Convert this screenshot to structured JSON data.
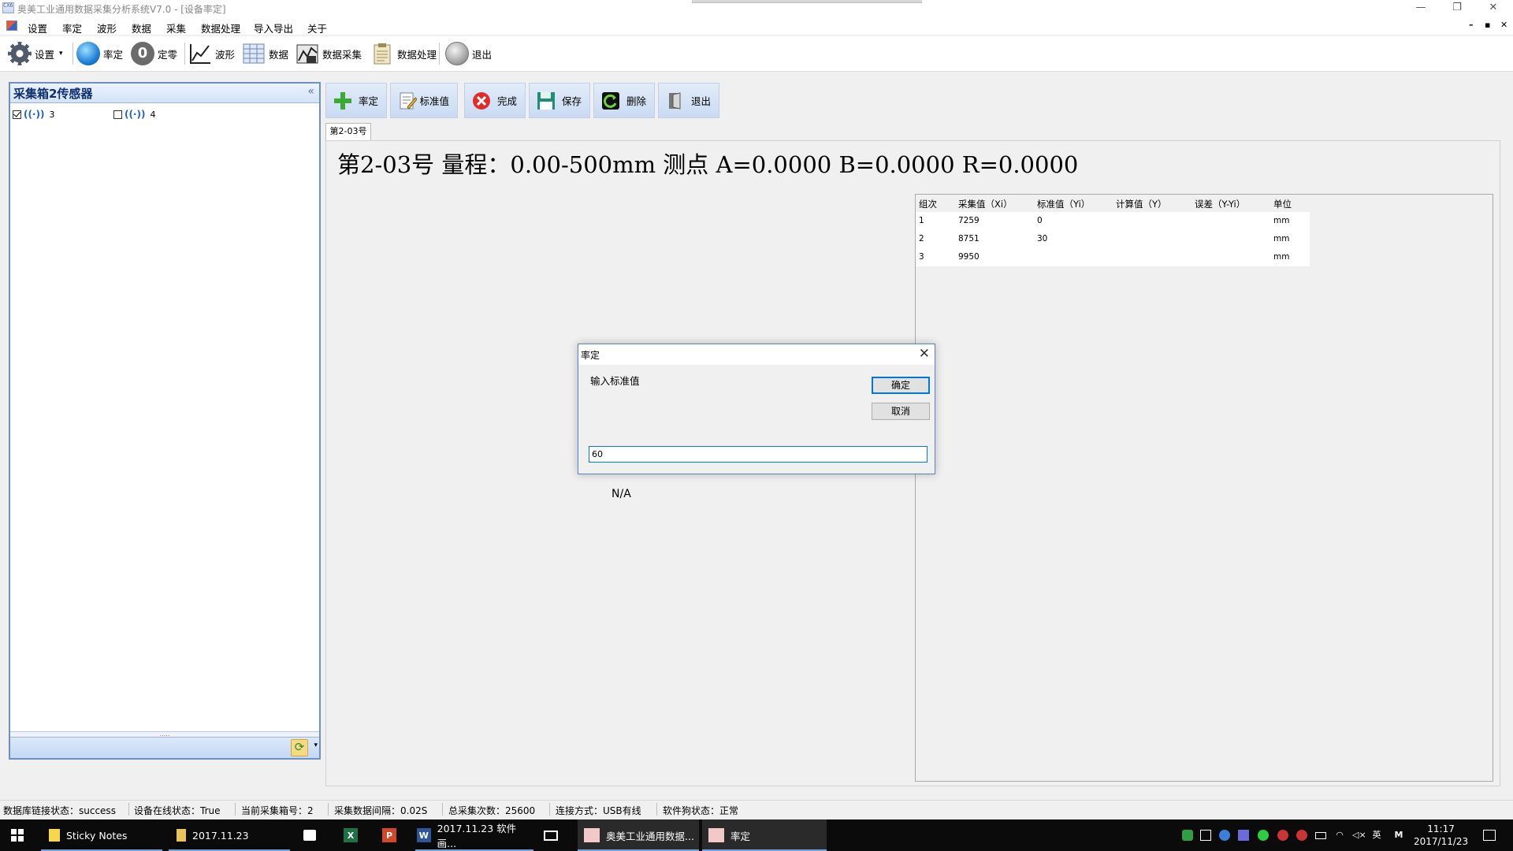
{
  "window": {
    "app_icon_text": "CX64",
    "title": "奥美工业通用数据采集分析系统V7.0 - [设备率定]",
    "minimize": "—",
    "restore": "❐",
    "close": "✕"
  },
  "menu": {
    "items": [
      "设置",
      "率定",
      "波形",
      "数据",
      "采集",
      "数据处理",
      "导入导出",
      "关于"
    ],
    "mdi_controls": [
      "–",
      "▪",
      "✕"
    ]
  },
  "toolbar": {
    "settings": "设置",
    "settings_dropdown": "▾",
    "calibrate": "率定",
    "zero_icon": "0",
    "zero": "定零",
    "waveform": "波形",
    "data": "数据",
    "data_collect": "数据采集",
    "data_process": "数据处理",
    "exit": "退出"
  },
  "left_panel": {
    "title": "采集箱2传感器",
    "collapse": "«",
    "sensors": [
      {
        "number": "3",
        "checked": true
      },
      {
        "number": "4",
        "checked": false
      }
    ],
    "sensor_icon": "((·))",
    "grip": ".....",
    "refresh_icon": "⟳",
    "refresh_dropdown": "▾"
  },
  "actions": {
    "calibrate": "率定",
    "standard_value": "标准值",
    "finish": "完成",
    "save": "保存",
    "delete": "删除",
    "exit": "退出"
  },
  "tab": {
    "label": "第2-03号"
  },
  "heading": "第2-03号 量程：0.00-500mm 测点 A=0.0000 B=0.0000 R=0.0000",
  "grid": {
    "headers": [
      "组次",
      "采集值（Xi）",
      "标准值（Yi）",
      "计算值（Y）",
      "误差（Y-Yi）",
      "单位"
    ],
    "rows": [
      {
        "group": "1",
        "collected": "7259",
        "standard": "0",
        "calculated": "",
        "error": "",
        "unit": "mm"
      },
      {
        "group": "2",
        "collected": "8751",
        "standard": "30",
        "calculated": "",
        "error": "",
        "unit": "mm"
      },
      {
        "group": "3",
        "collected": "9950",
        "standard": "",
        "calculated": "",
        "error": "",
        "unit": "mm"
      }
    ]
  },
  "na_text": "N/A",
  "dialog": {
    "title": "率定",
    "close": "✕",
    "prompt": "输入标准值",
    "ok": "确定",
    "cancel": "取消",
    "input_value": "60"
  },
  "status": {
    "db_link": "数据库链接状态：success",
    "device_online": "设备在线状态：True",
    "current_box": "当前采集箱号：2",
    "interval": "采集数据间隔：0.02S",
    "total_count": "总采集次数：25600",
    "connection": "连接方式：USB有线",
    "dongle": "软件狗状态：正常"
  },
  "taskbar": {
    "sticky_notes": "Sticky Notes",
    "folder": "2017.11.23",
    "word_doc": "2017.11.23 软件画...",
    "app_main": "奥美工业通用数据...",
    "app_dialog": "率定",
    "excel_letter": "X",
    "ppt_letter": "P",
    "word_letter": "W",
    "lang": "英",
    "ime": "M",
    "time": "11:17",
    "date": "2017/11/23"
  },
  "colors": {
    "accent": "#0078d7",
    "panel_border": "#6e8fc2",
    "action_bg": "#c9daf2",
    "taskbar": "#0b0b0b"
  }
}
